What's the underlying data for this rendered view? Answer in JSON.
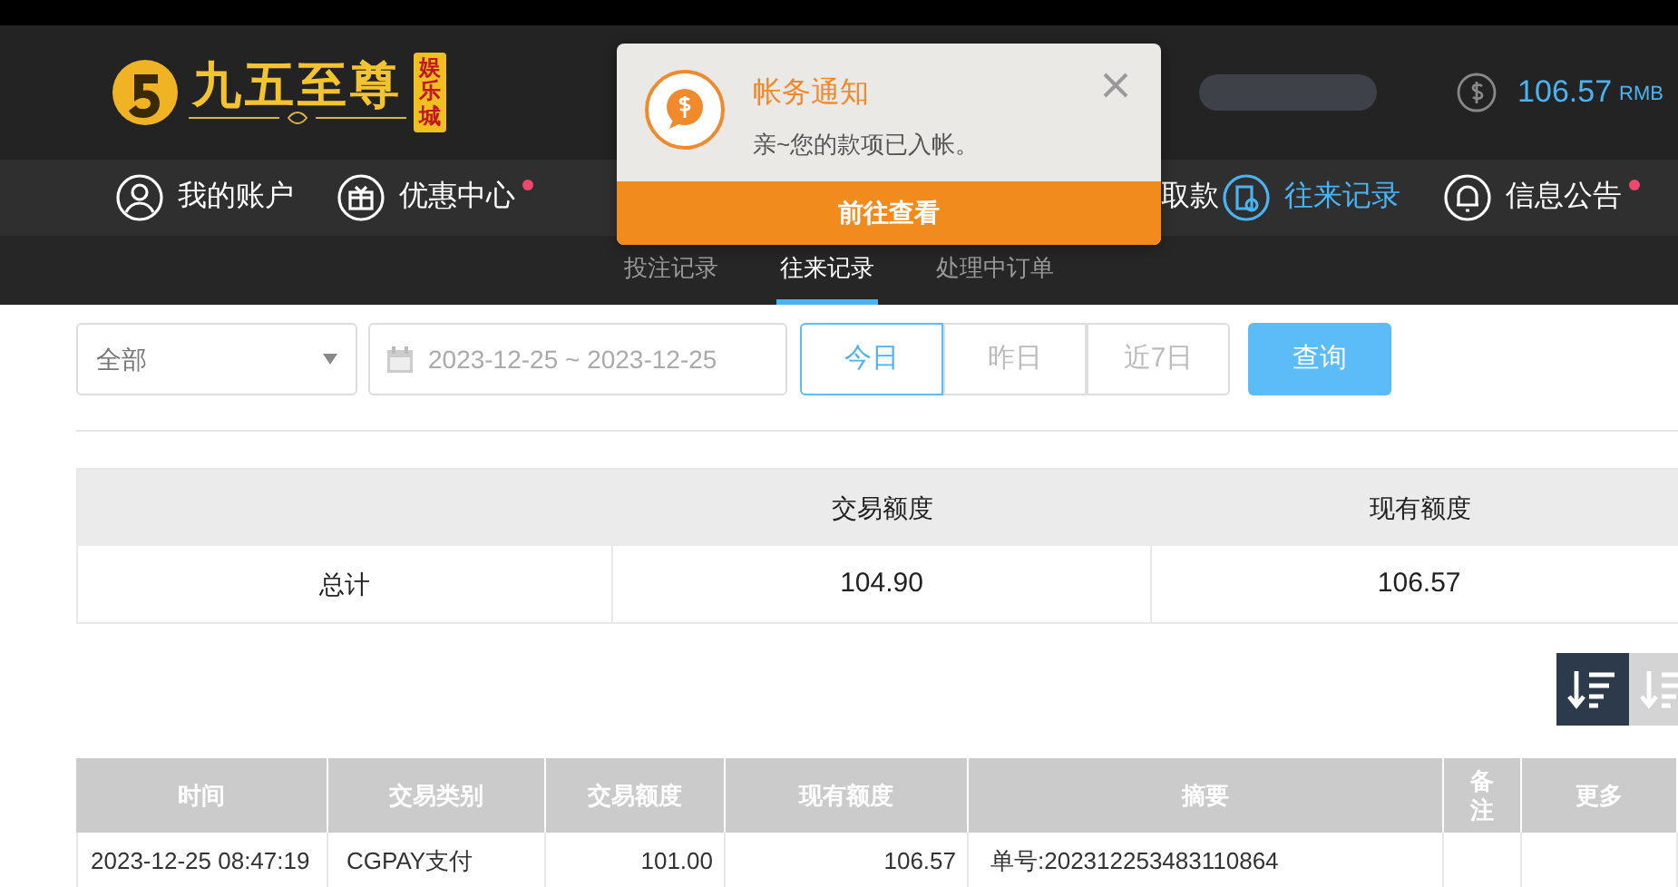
{
  "header": {
    "logo_text": "九五至尊",
    "logo_badge": "娱乐城",
    "balance": "106.57",
    "currency": "RMB"
  },
  "nav": [
    {
      "kind": "account",
      "label": "我的账户",
      "dot": false,
      "selected": false
    },
    {
      "kind": "offers",
      "label": "优惠中心",
      "dot": true,
      "selected": false
    },
    {
      "kind": "covered"
    },
    {
      "kind": "covered"
    },
    {
      "kind": "label_only",
      "label": "取款",
      "selected": false
    },
    {
      "kind": "records",
      "label": "往来记录",
      "dot": false,
      "selected": true
    },
    {
      "kind": "notices",
      "label": "信息公告",
      "dot": true,
      "selected": false
    }
  ],
  "notification": {
    "title": "帐务通知",
    "message": "亲~您的款项已入帐。",
    "action": "前往查看"
  },
  "subtabs": [
    {
      "label": "投注记录",
      "selected": false
    },
    {
      "label": "往来记录",
      "selected": true
    },
    {
      "label": "处理中订单",
      "selected": false
    }
  ],
  "filters": {
    "type_select": "全部",
    "date_range": "2023-12-25 ~ 2023-12-25",
    "ranges": [
      {
        "label": "今日",
        "selected": true
      },
      {
        "label": "昨日",
        "selected": false
      },
      {
        "label": "近7日",
        "selected": false
      }
    ],
    "query_button": "查询"
  },
  "summary": {
    "columns": [
      "交易额度",
      "现有额度"
    ],
    "row_label": "总计",
    "values": [
      "104.90",
      "106.57"
    ]
  },
  "sort_buttons": [
    {
      "selected": true
    },
    {
      "selected": false
    }
  ],
  "table": {
    "columns": [
      "时间",
      "交易类别",
      "交易额度",
      "现有额度",
      "摘要",
      "备注",
      "更多"
    ],
    "rows": [
      [
        "2023-12-25 08:47:19",
        "CGPAY支付",
        "101.00",
        "106.57",
        "单号:202312253483110864",
        "",
        ""
      ]
    ]
  }
}
